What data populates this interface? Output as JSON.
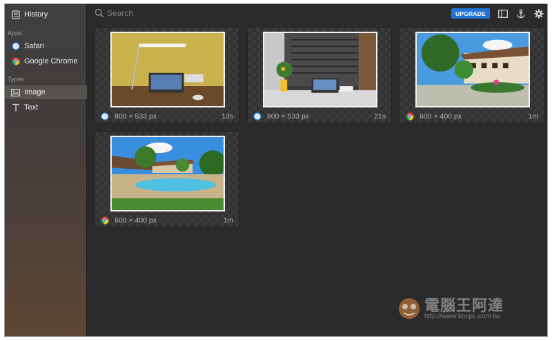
{
  "sidebar": {
    "history": {
      "label": "History",
      "icon": "history-icon"
    },
    "sections": [
      {
        "title": "Apps"
      },
      {
        "title": "Types"
      }
    ],
    "apps": [
      {
        "label": "Safari",
        "icon": "safari-icon"
      },
      {
        "label": "Google Chrome",
        "icon": "chrome-icon"
      }
    ],
    "types": [
      {
        "label": "Image",
        "icon": "image-icon",
        "active": true
      },
      {
        "label": "Text",
        "icon": "text-icon",
        "active": false
      }
    ]
  },
  "toolbar": {
    "search_placeholder": "Search",
    "upgrade_label": "UPGRADE",
    "icons": [
      "sidebar-toggle-icon",
      "anchor-icon",
      "gear-icon"
    ],
    "accent": "#1f74d6"
  },
  "items": [
    {
      "source": "safari",
      "dims": "800 × 533 px",
      "age": "13s",
      "image": "desk-lamp-warm"
    },
    {
      "source": "safari",
      "dims": "800 × 533 px",
      "age": "21s",
      "image": "desk-lamp-cool"
    },
    {
      "source": "chrome",
      "dims": "600 × 400 px",
      "age": "1m",
      "image": "resort-garden"
    },
    {
      "source": "chrome",
      "dims": "600 × 400 px",
      "age": "1m",
      "image": "resort-pool"
    }
  ],
  "watermark": {
    "title": "電腦王阿達",
    "url": "http://www.kocpc.com.tw"
  }
}
